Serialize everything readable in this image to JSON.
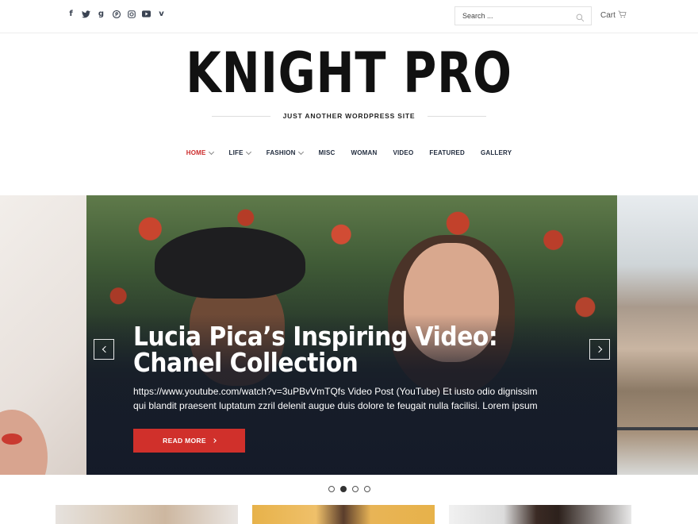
{
  "header": {
    "social_icons": [
      "facebook-icon",
      "twitter-icon",
      "google-plus-icon",
      "pinterest-icon",
      "instagram-icon",
      "youtube-icon",
      "vimeo-icon"
    ],
    "search": {
      "placeholder": "Search ..."
    },
    "cart_label": "Cart"
  },
  "branding": {
    "site_title": "KNIGHT PRO",
    "tagline": "JUST ANOTHER WORDPRESS SITE"
  },
  "nav": {
    "items": [
      {
        "label": "HOME",
        "active": true,
        "has_dropdown": true
      },
      {
        "label": "LIFE",
        "active": false,
        "has_dropdown": true
      },
      {
        "label": "FASHION",
        "active": false,
        "has_dropdown": true
      },
      {
        "label": "MISC",
        "active": false,
        "has_dropdown": false
      },
      {
        "label": "WOMAN",
        "active": false,
        "has_dropdown": false
      },
      {
        "label": "VIDEO",
        "active": false,
        "has_dropdown": false
      },
      {
        "label": "FEATURED",
        "active": false,
        "has_dropdown": false
      },
      {
        "label": "GALLERY",
        "active": false,
        "has_dropdown": false
      }
    ]
  },
  "slider": {
    "title": "Lucia Pica’s Inspiring Video: Chanel Collection",
    "excerpt": "https://www.youtube.com/watch?v=3uPBvVmTQfs Video Post (YouTube) Et iusto odio dignissim qui blandit praesent luptatum zzril delenit augue duis dolore te feugait nulla facilisi. Lorem ipsum",
    "read_more": "READ MORE",
    "dots_count": 4,
    "active_dot": 2
  },
  "colors": {
    "accent": "#d0302b",
    "nav_active": "#cc2a2a",
    "nav_text": "#1f2a3c",
    "title_text": "#111111"
  }
}
